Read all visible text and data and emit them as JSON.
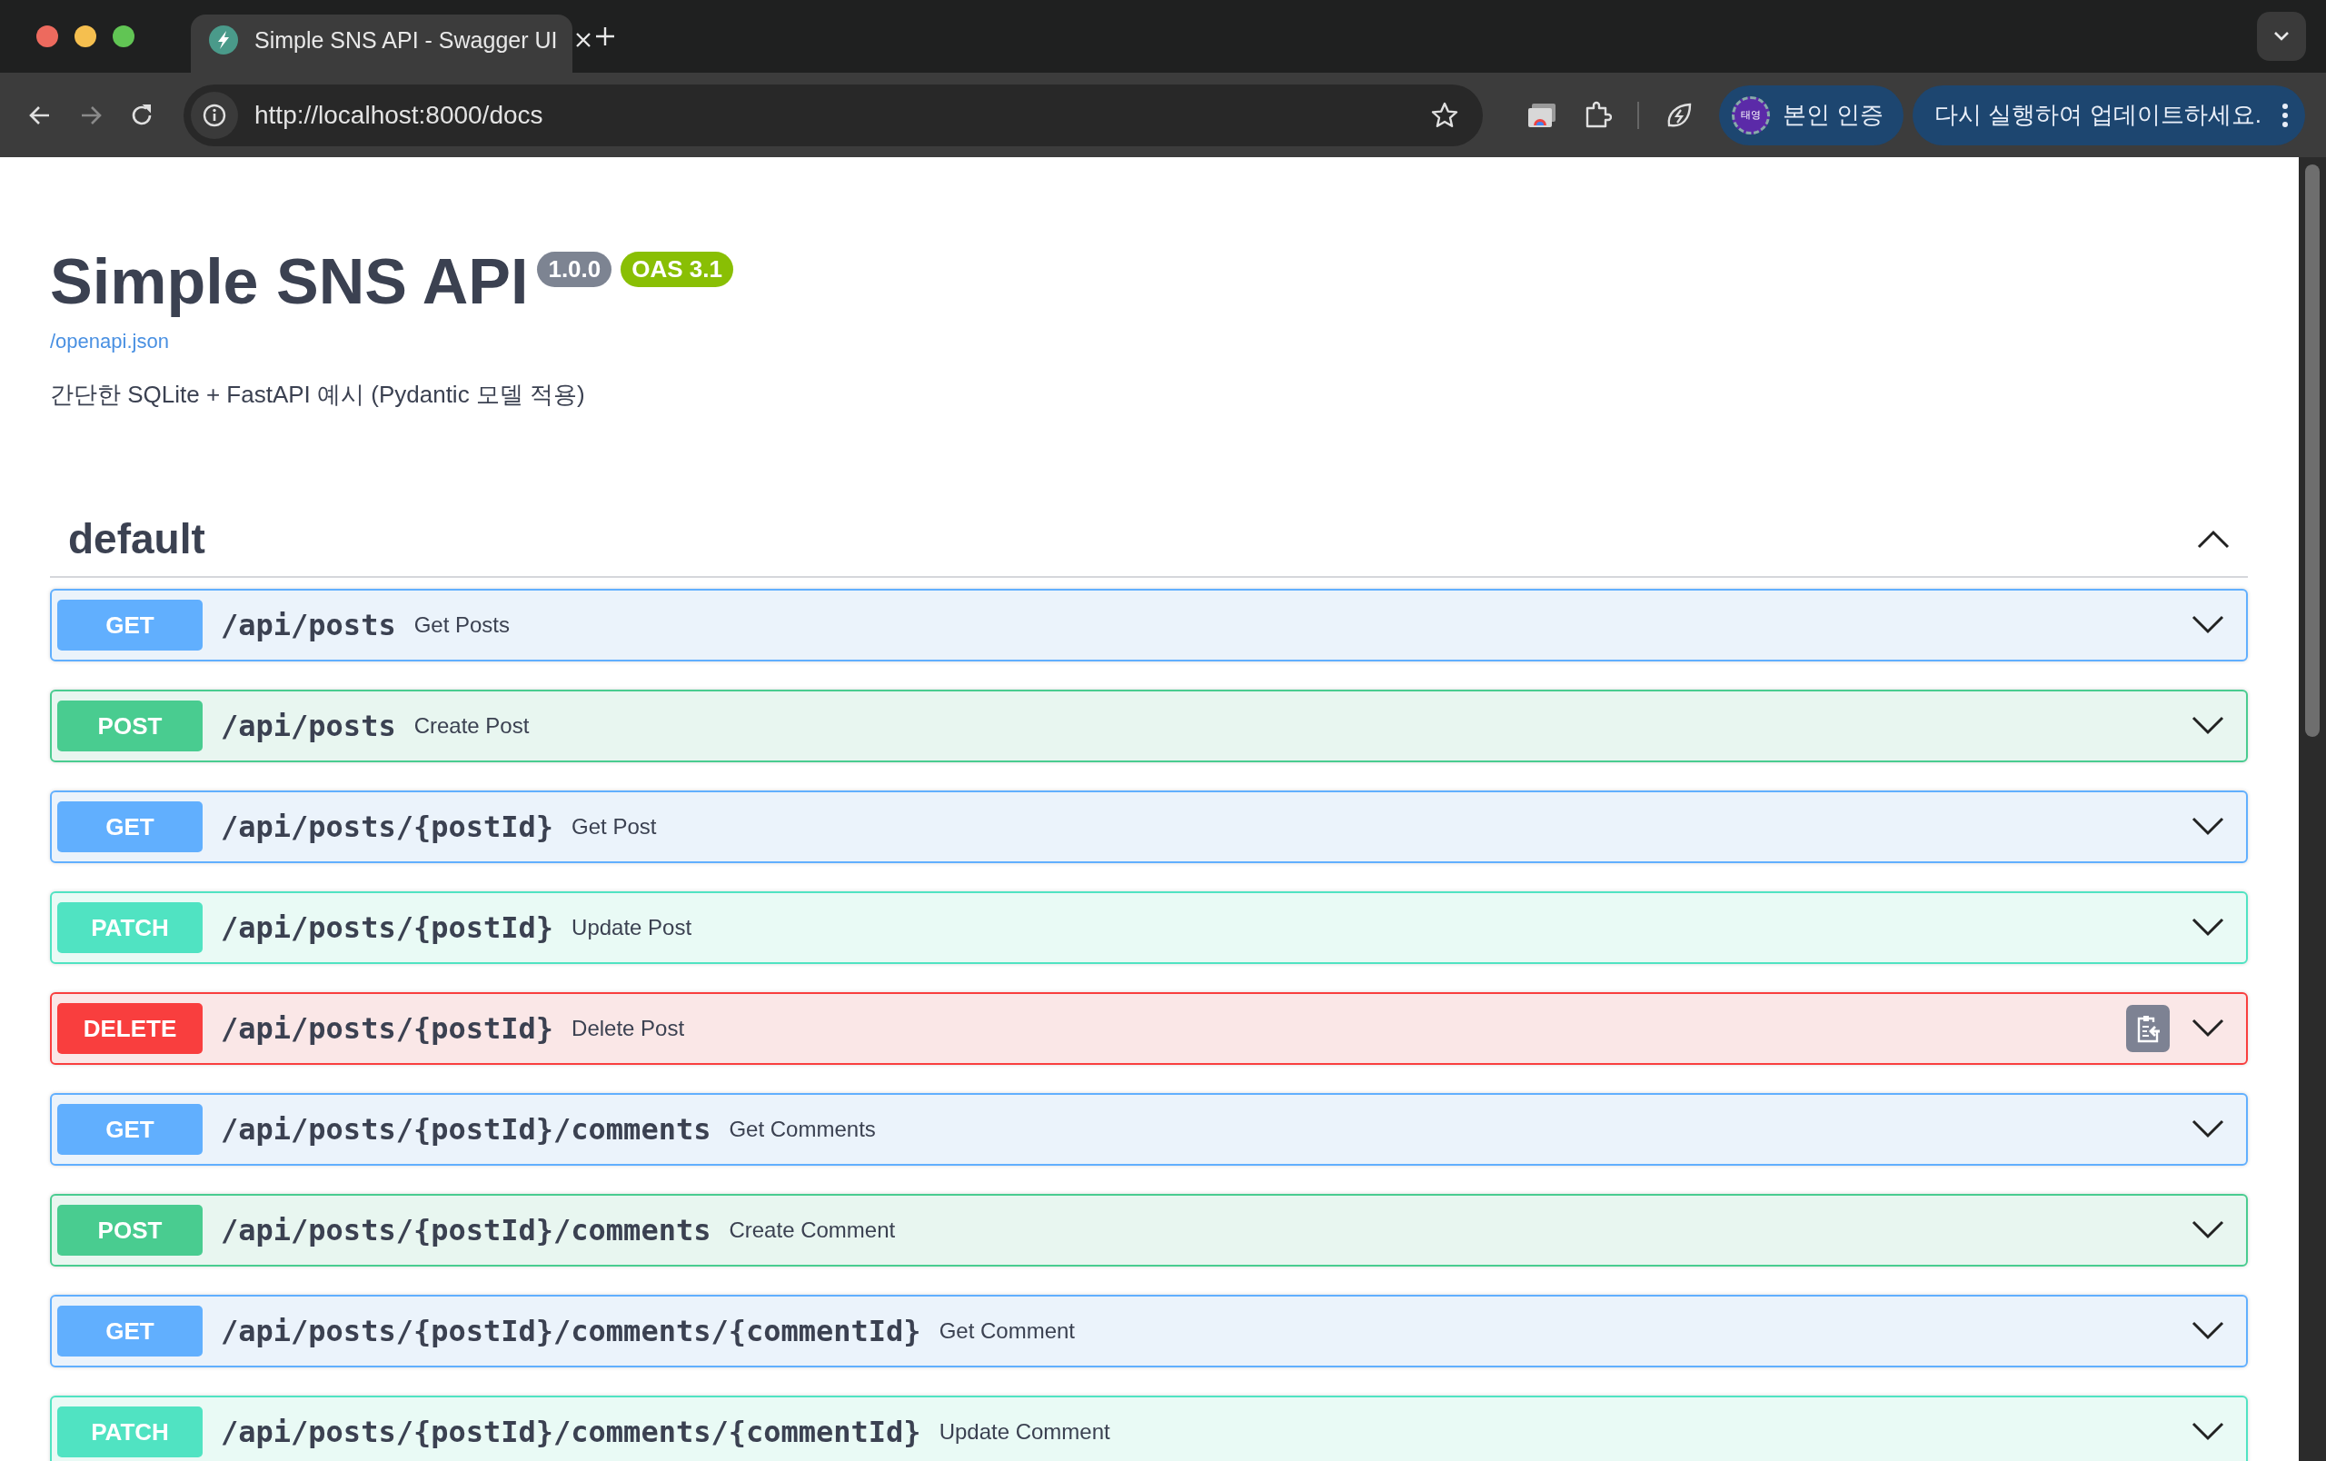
{
  "browser": {
    "tab": {
      "title": "Simple SNS API - Swagger UI"
    },
    "address": {
      "url": "http://localhost:8000/docs"
    },
    "profile": {
      "avatar": "태영",
      "label": "본인 인증"
    },
    "update_button": "다시 실행하여 업데이트하세요."
  },
  "info": {
    "title": "Simple SNS API",
    "version": "1.0.0",
    "oas": "OAS 3.1",
    "spec_link": "/openapi.json",
    "description": "간단한 SQLite + FastAPI 예시 (Pydantic 모델 적용)"
  },
  "tag": {
    "name": "default",
    "expanded": true
  },
  "operations": [
    {
      "method": "GET",
      "path": "/api/posts",
      "summary": "Get Posts",
      "expanded": false,
      "hovered": false
    },
    {
      "method": "POST",
      "path": "/api/posts",
      "summary": "Create Post",
      "expanded": false,
      "hovered": false
    },
    {
      "method": "GET",
      "path": "/api/posts/{postId}",
      "summary": "Get Post",
      "expanded": false,
      "hovered": false
    },
    {
      "method": "PATCH",
      "path": "/api/posts/{postId}",
      "summary": "Update Post",
      "expanded": false,
      "hovered": false
    },
    {
      "method": "DELETE",
      "path": "/api/posts/{postId}",
      "summary": "Delete Post",
      "expanded": false,
      "hovered": true
    },
    {
      "method": "GET",
      "path": "/api/posts/{postId}/comments",
      "summary": "Get Comments",
      "expanded": false,
      "hovered": false
    },
    {
      "method": "POST",
      "path": "/api/posts/{postId}/comments",
      "summary": "Create Comment",
      "expanded": false,
      "hovered": false
    },
    {
      "method": "GET",
      "path": "/api/posts/{postId}/comments/{commentId}",
      "summary": "Get Comment",
      "expanded": false,
      "hovered": false
    },
    {
      "method": "PATCH",
      "path": "/api/posts/{postId}/comments/{commentId}",
      "summary": "Update Comment",
      "expanded": false,
      "hovered": false
    }
  ]
}
